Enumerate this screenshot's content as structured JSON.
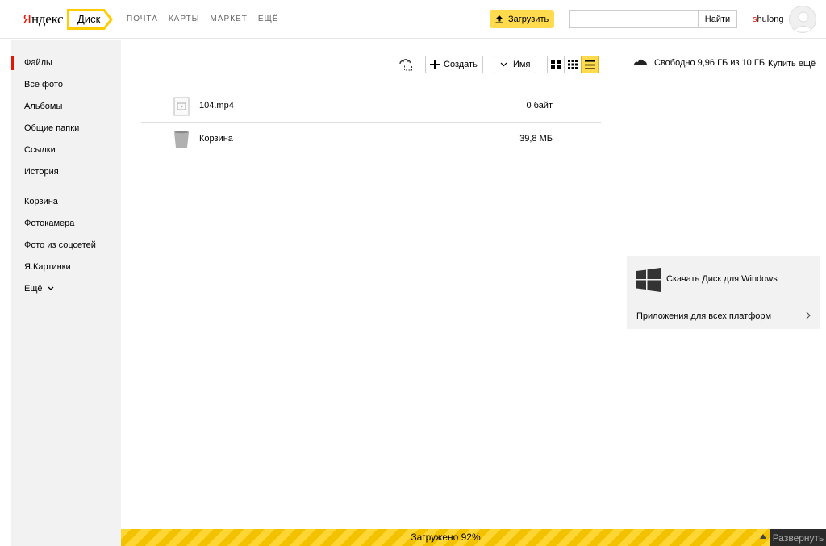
{
  "header": {
    "logo_text": "Яндекс",
    "service_name": "Диск",
    "nav": [
      "ПОЧТА",
      "КАРТЫ",
      "МАРКЕТ",
      "ЕЩЁ"
    ],
    "upload_label": "Загрузить",
    "search_value": "",
    "search_button": "Найти",
    "username": "shulong"
  },
  "sidebar": {
    "items": [
      "Файлы",
      "Все фото",
      "Альбомы",
      "Общие папки",
      "Ссылки",
      "История",
      "Корзина",
      "Фотокамера",
      "Фото из соцсетей",
      "Я.Картинки",
      "Ещё"
    ],
    "active": "Файлы"
  },
  "toolbar": {
    "create_label": "Создать",
    "sort_label": "Имя"
  },
  "quota": {
    "text": "Свободно 9,96 ГБ из 10 ГБ.",
    "buy_label": "Купить ещё"
  },
  "files": [
    {
      "name": "104.mp4",
      "size": "0 байт",
      "icon": "video-file-icon"
    },
    {
      "name": "Корзина",
      "size": "39,8 МБ",
      "icon": "trash-bin-icon"
    }
  ],
  "promo": {
    "download_label": "Скачать Диск для Windows",
    "apps_label": "Приложения для всех платформ"
  },
  "upload_status": {
    "text": "Загружено 92%",
    "percent": 92,
    "expand_label": "Развернуть"
  },
  "colors": {
    "accent_yellow": "#ffdb4d",
    "brand_red": "#e61400"
  }
}
